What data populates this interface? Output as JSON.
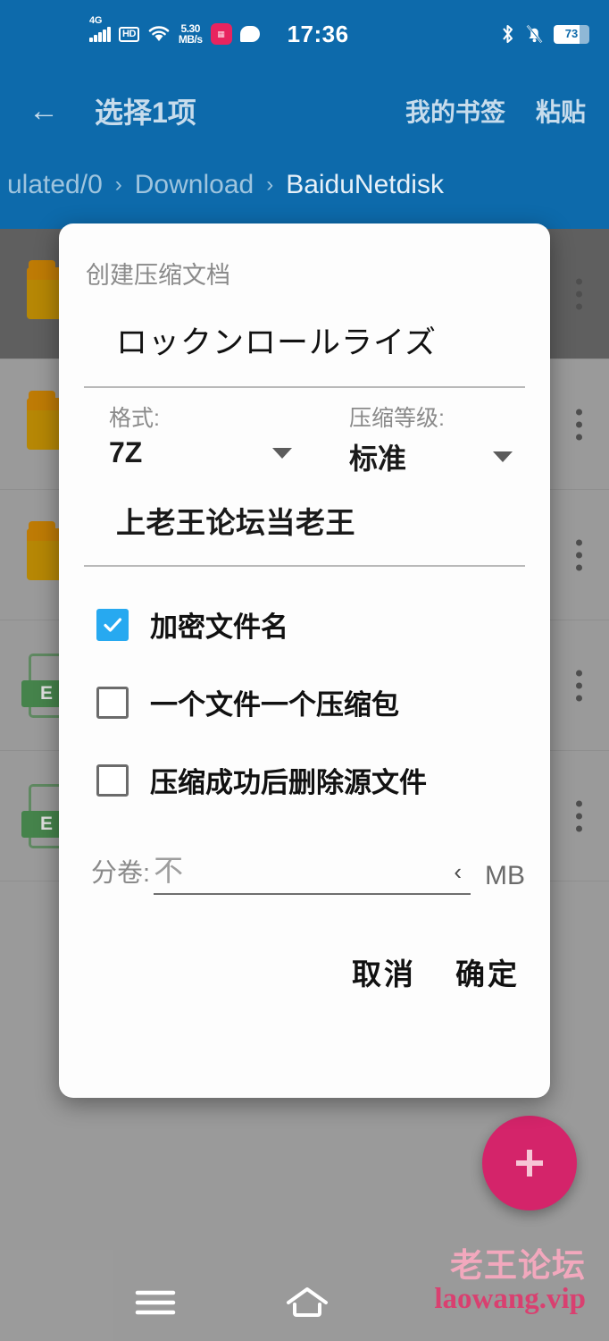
{
  "status_bar": {
    "network_type": "4G",
    "hd_label": "HD",
    "speed_value": "5.30",
    "speed_unit": "MB/s",
    "app_icon": "pink-app-icon",
    "message_icon": "chat-bubble-icon",
    "clock": "17:36",
    "bluetooth_icon": "bluetooth-icon",
    "mute_icon": "bell-muted-icon",
    "battery_level": "73"
  },
  "app_bar": {
    "back_icon": "back-arrow-icon",
    "title": "选择1项",
    "actions": [
      {
        "label": "我的书签",
        "name": "my-bookmarks"
      },
      {
        "label": "粘贴",
        "name": "paste"
      }
    ],
    "breadcrumb": {
      "separator": "›",
      "crumbs": [
        {
          "label": "ulated/0",
          "current": false
        },
        {
          "label": "Download",
          "current": false
        },
        {
          "label": "BaiduNetdisk",
          "current": true
        }
      ]
    },
    "background_color": "#0d6aab"
  },
  "file_list": {
    "rows": [
      {
        "icon": "folder-icon",
        "selected": true,
        "overflow_icon": "more-vertical-icon"
      },
      {
        "icon": "folder-icon",
        "selected": false,
        "overflow_icon": "more-vertical-icon"
      },
      {
        "icon": "folder-icon",
        "selected": false,
        "overflow_icon": "more-vertical-icon"
      },
      {
        "icon": "excel-file-icon",
        "badge": "E",
        "selected": false,
        "overflow_icon": "more-vertical-icon"
      },
      {
        "icon": "excel-file-icon",
        "badge": "E",
        "selected": false,
        "overflow_icon": "more-vertical-icon"
      }
    ]
  },
  "dialog": {
    "title": "创建压缩文档",
    "filename": {
      "value": "ロックンロールライズ"
    },
    "format": {
      "label": "格式:",
      "value": "7Z"
    },
    "level": {
      "label": "压缩等级:",
      "value": "标准"
    },
    "password": {
      "value": "上老王论坛当老王"
    },
    "checkboxes": [
      {
        "label": "加密文件名",
        "checked": true,
        "name": "encrypt-filenames"
      },
      {
        "label": "一个文件一个压缩包",
        "checked": false,
        "name": "one-archive-per-file"
      },
      {
        "label": "压缩成功后删除源文件",
        "checked": false,
        "name": "delete-source-after"
      }
    ],
    "split": {
      "label": "分卷:",
      "placeholder": "不",
      "chevron": "‹",
      "unit": "MB"
    },
    "buttons": {
      "cancel": "取消",
      "confirm": "确定"
    },
    "accent_color": "#27a9f0"
  },
  "fab": {
    "icon": "plus-icon",
    "color": "#d4246a"
  },
  "watermark": {
    "line1": "老王论坛",
    "line2": "laowang.vip"
  },
  "nav_bar": {
    "recents_icon": "menu-recents-icon",
    "home_icon": "home-icon"
  }
}
